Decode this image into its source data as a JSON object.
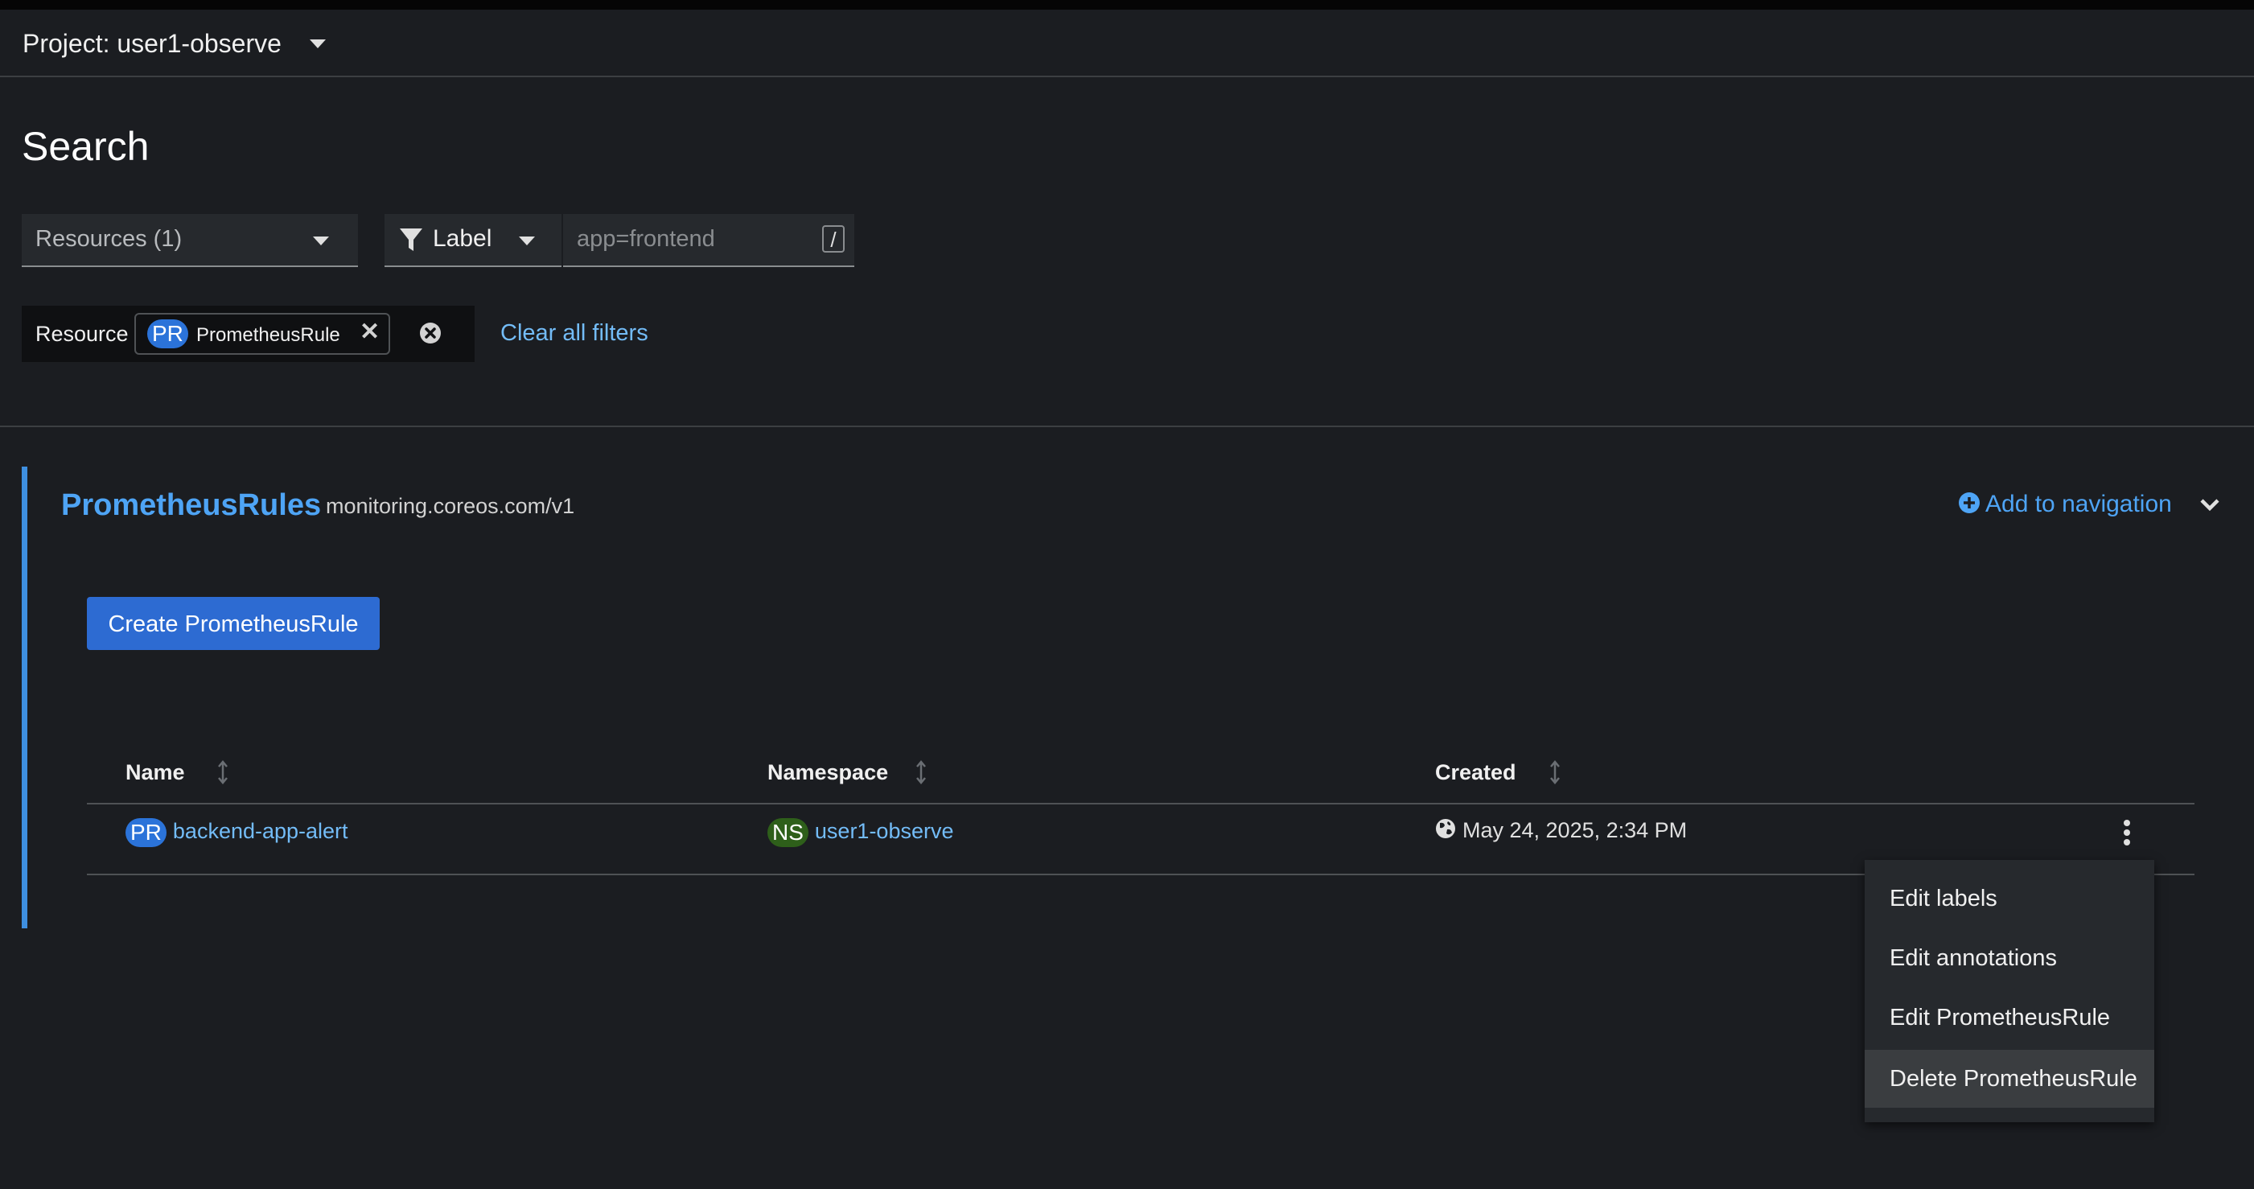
{
  "project": {
    "label": "Project: user1-observe"
  },
  "page": {
    "title": "Search"
  },
  "filters": {
    "resources_dropdown": "Resources (1)",
    "label_dropdown": "Label",
    "label_input_placeholder": "app=frontend",
    "shortcut_key": "/",
    "chip_group_category": "Resource",
    "chip": {
      "badge": "PR",
      "label": "PrometheusRule"
    },
    "clear_all": "Clear all filters"
  },
  "section": {
    "title": "PrometheusRules",
    "api_version": "monitoring.coreos.com/v1",
    "add_to_navigation": "Add to navigation",
    "create_button": "Create PrometheusRule"
  },
  "table": {
    "columns": [
      "Name",
      "Namespace",
      "Created"
    ],
    "rows": [
      {
        "name_badge": "PR",
        "name": "backend-app-alert",
        "namespace_badge": "NS",
        "namespace": "user1-observe",
        "created": "May 24, 2025, 2:34 PM"
      }
    ]
  },
  "kebab_menu": {
    "items": [
      "Edit labels",
      "Edit annotations",
      "Edit PrometheusRule",
      "Delete PrometheusRule"
    ],
    "highlighted_index": 3
  },
  "colors": {
    "background": "#1b1d21",
    "link": "#73bcf7",
    "primary_button": "#2d6bd2",
    "section_accent": "#3e8fe0",
    "pr_badge": "#2b73d9",
    "ns_badge": "#2e5f1a"
  }
}
